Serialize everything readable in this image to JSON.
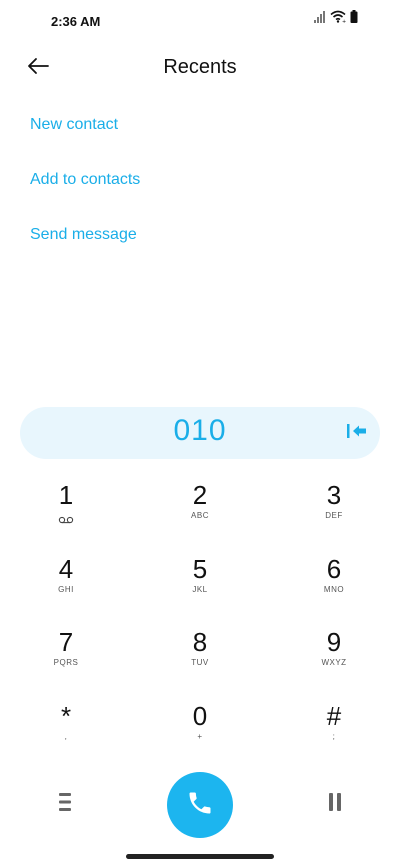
{
  "status_bar": {
    "time": "2:36 AM",
    "icons": [
      "signal-icon",
      "wifi-icon",
      "battery-icon"
    ]
  },
  "header": {
    "title": "Recents",
    "back_icon": "arrow-left-icon"
  },
  "actions": {
    "new_contact": "New contact",
    "add_to_contacts": "Add to contacts",
    "send_message": "Send message"
  },
  "dialer": {
    "number": "010",
    "backspace_icon": "backspace-icon"
  },
  "keypad": {
    "keys": [
      {
        "digit": "1",
        "sub": "",
        "sub_icon": "voicemail-icon"
      },
      {
        "digit": "2",
        "sub": "ABC"
      },
      {
        "digit": "3",
        "sub": "DEF"
      },
      {
        "digit": "4",
        "sub": "GHI"
      },
      {
        "digit": "5",
        "sub": "JKL"
      },
      {
        "digit": "6",
        "sub": "MNO"
      },
      {
        "digit": "7",
        "sub": "PQRS"
      },
      {
        "digit": "8",
        "sub": "TUV"
      },
      {
        "digit": "9",
        "sub": "WXYZ"
      },
      {
        "digit": "*",
        "sub": ","
      },
      {
        "digit": "0",
        "sub": "+"
      },
      {
        "digit": "#",
        "sub": ";"
      }
    ]
  },
  "bottom_bar": {
    "menu_icon": "menu-icon",
    "call_icon": "phone-icon",
    "pause_icon": "pause-icon"
  },
  "colors": {
    "accent": "#1aaee8",
    "call_button": "#1cb5ef",
    "number_bar_bg": "#e8f6fd"
  }
}
